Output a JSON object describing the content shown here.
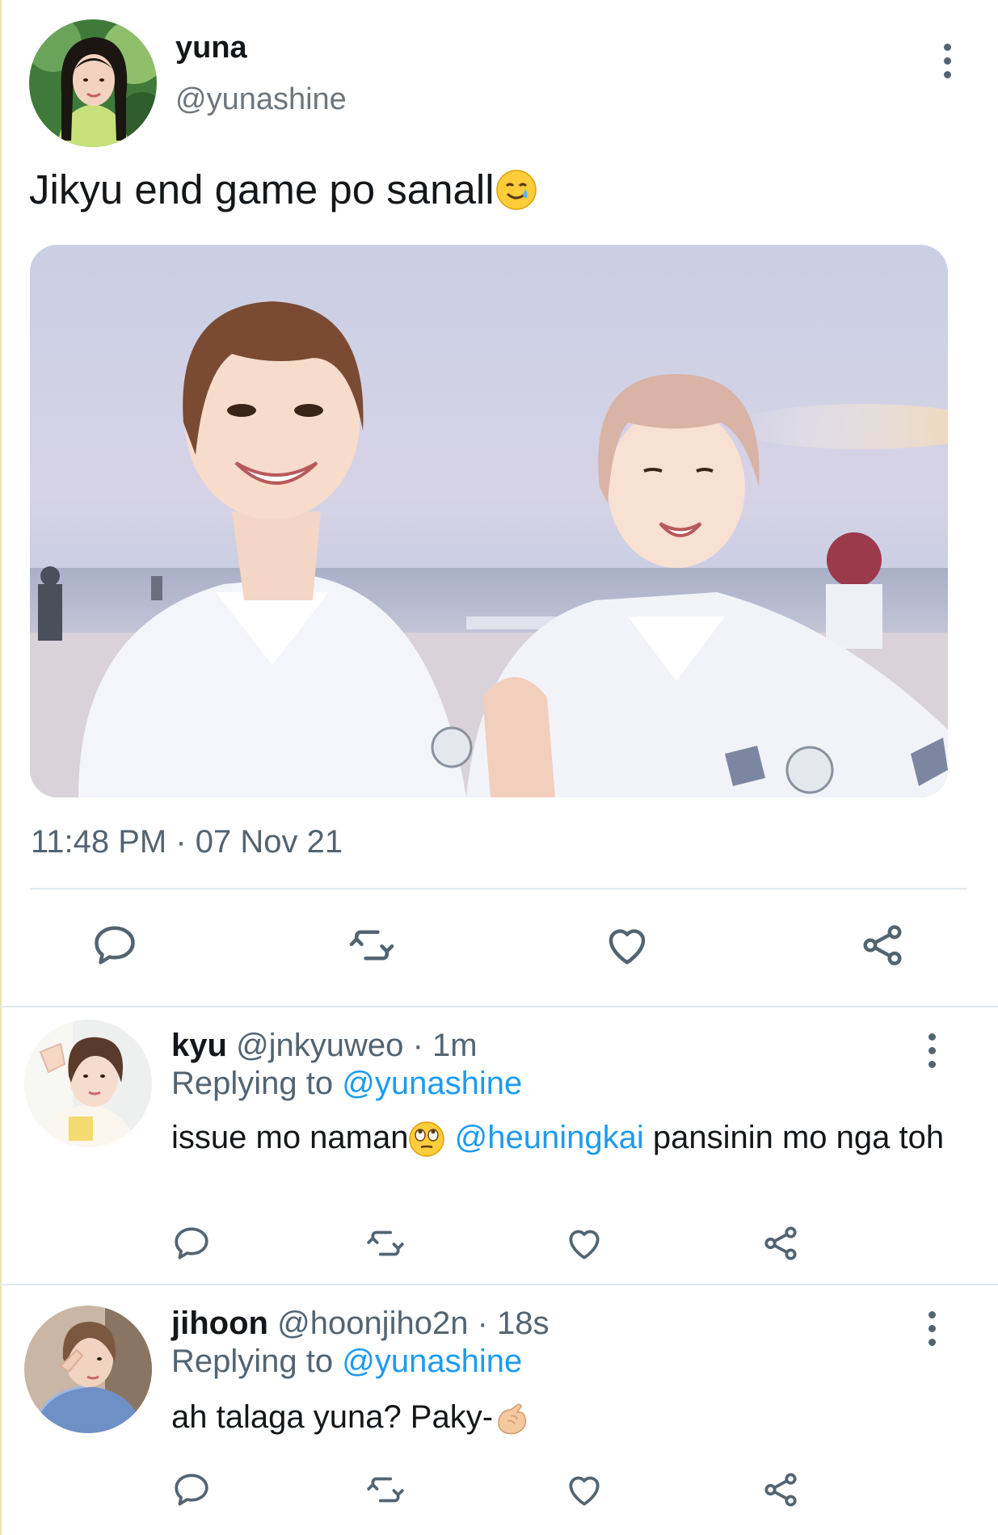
{
  "main_tweet": {
    "display_name": "yuna",
    "handle": "@yunashine",
    "text": "Jikyu end game po sanall",
    "text_emoji": "smiling-face-with-tear",
    "timestamp": "11:48 PM · 07 Nov 21",
    "actions": [
      "reply-icon",
      "retweet-icon",
      "like-icon",
      "share-icon"
    ]
  },
  "replies": [
    {
      "display_name": "kyu",
      "handle": "@jnkyuweo",
      "time": "1m",
      "replying_prefix": "Replying to",
      "replying_to": "@yunashine",
      "text_before": "issue mo naman",
      "emoji": "face-with-rolling-eyes",
      "mention": "@heuningkai",
      "text_after": " pansinin mo nga toh"
    },
    {
      "display_name": "jihoon",
      "handle": "@hoonjiho2n",
      "time": "18s",
      "replying_prefix": "Replying to",
      "replying_to": "@yunashine",
      "text_before": "ah talaga yuna? Paky-",
      "emoji": "pinching-hand"
    }
  ],
  "colors": {
    "text": "#14171a",
    "secondary": "#536471",
    "link": "#1d9bf0",
    "divider": "#e1e8ed"
  }
}
